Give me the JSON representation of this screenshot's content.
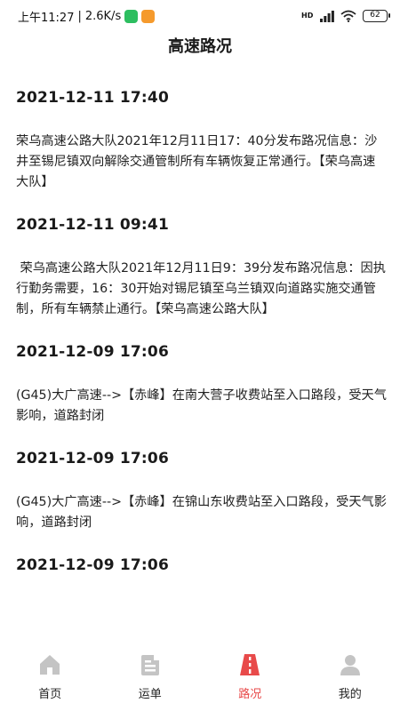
{
  "status_bar": {
    "time": "上午11:27",
    "network_speed": "2.6K/s",
    "signal_label": "HD",
    "battery": "62",
    "icons": [
      "wechat-icon",
      "app-notification-icon",
      "signal-icon",
      "wifi-icon",
      "battery-icon"
    ]
  },
  "page": {
    "title": "高速路况"
  },
  "feed": [
    {
      "time": "2021-12-11 17:40",
      "text": "荣乌高速公路大队2021年12月11日17：40分发布路况信息：沙井至锡尼镇双向解除交通管制所有车辆恢复正常通行。【荣乌高速大队】"
    },
    {
      "time": "2021-12-11 09:41",
      "text": " 荣乌高速公路大队2021年12月11日9：39分发布路况信息：因执行勤务需要，16：30开始对锡尼镇至乌兰镇双向道路实施交通管制，所有车辆禁止通行。【荣乌高速公路大队】"
    },
    {
      "time": "2021-12-09 17:06",
      "text": "(G45)大广高速-->【赤峰】在南大营子收费站至入口路段，受天气影响，道路封闭"
    },
    {
      "time": "2021-12-09 17:06",
      "text": "(G45)大广高速-->【赤峰】在锦山东收费站至入口路段，受天气影响，道路封闭"
    },
    {
      "time": "2021-12-09 17:06",
      "text": ""
    }
  ],
  "tabbar": {
    "active_color": "#e84a4a",
    "inactive_color": "#c4c4c4",
    "items": [
      {
        "label": "首页",
        "icon": "home-icon",
        "active": false
      },
      {
        "label": "运单",
        "icon": "waybill-icon",
        "active": false
      },
      {
        "label": "路况",
        "icon": "road-icon",
        "active": true
      },
      {
        "label": "我的",
        "icon": "user-icon",
        "active": false
      }
    ]
  }
}
